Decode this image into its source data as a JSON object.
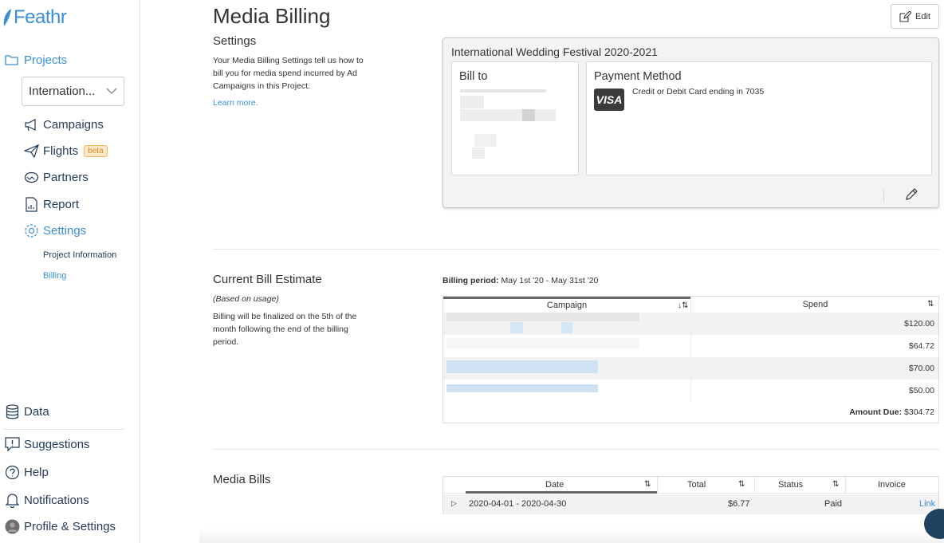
{
  "brand": {
    "name": "Feathr",
    "color": "#3a8fd9"
  },
  "sidebar": {
    "projects_label": "Projects",
    "project_select": "Internation...",
    "items": [
      {
        "label": "Campaigns",
        "icon": "megaphone-icon"
      },
      {
        "label": "Flights",
        "icon": "paper-plane-icon",
        "badge": "beta"
      },
      {
        "label": "Partners",
        "icon": "handshake-icon"
      },
      {
        "label": "Report",
        "icon": "report-icon"
      },
      {
        "label": "Settings",
        "icon": "gear-icon"
      }
    ],
    "sub_items": [
      {
        "label": "Project Information"
      },
      {
        "label": "Billing"
      }
    ],
    "bottom_items": [
      {
        "label": "Data",
        "icon": "database-icon"
      },
      {
        "label": "Suggestions",
        "icon": "suggestion-icon"
      },
      {
        "label": "Help",
        "icon": "help-icon"
      },
      {
        "label": "Notifications",
        "icon": "bell-icon"
      },
      {
        "label": "Profile & Settings",
        "icon": "avatar"
      }
    ]
  },
  "header": {
    "title": "Media Billing",
    "edit_label": "Edit"
  },
  "settings": {
    "title": "Settings",
    "description": "Your Media Billing Settings tell us how to bill you for media spend incurred by Ad Campaigns in this Project.",
    "learn_more": "Learn more.",
    "card": {
      "project_name": "International Wedding Festival 2020-2021",
      "bill_to_label": "Bill to",
      "payment_method_label": "Payment Method",
      "card_brand": "VISA",
      "card_text": "Credit or Debit Card ending in 7035"
    }
  },
  "estimate": {
    "title": "Current Bill Estimate",
    "subtitle": "(Based on usage)",
    "description": "Billing will be finalized on the 5th of the month following the end of the billing period.",
    "billing_period_label": "Billing period:",
    "billing_period_value": "May 1st '20 - May 31st '20",
    "columns": [
      "Campaign",
      "Spend"
    ],
    "rows": [
      {
        "spend": "$120.00"
      },
      {
        "spend": "$64.72"
      },
      {
        "spend": "$70.00"
      },
      {
        "spend": "$50.00"
      }
    ],
    "amount_due_label": "Amount Due:",
    "amount_due_value": "$304.72"
  },
  "media_bills": {
    "title": "Media Bills",
    "columns": [
      "Date",
      "Total",
      "Status",
      "Invoice"
    ],
    "rows": [
      {
        "date": "2020-04-01 - 2020-04-30",
        "total": "$6.77",
        "status": "Paid",
        "invoice": "Link"
      }
    ]
  }
}
